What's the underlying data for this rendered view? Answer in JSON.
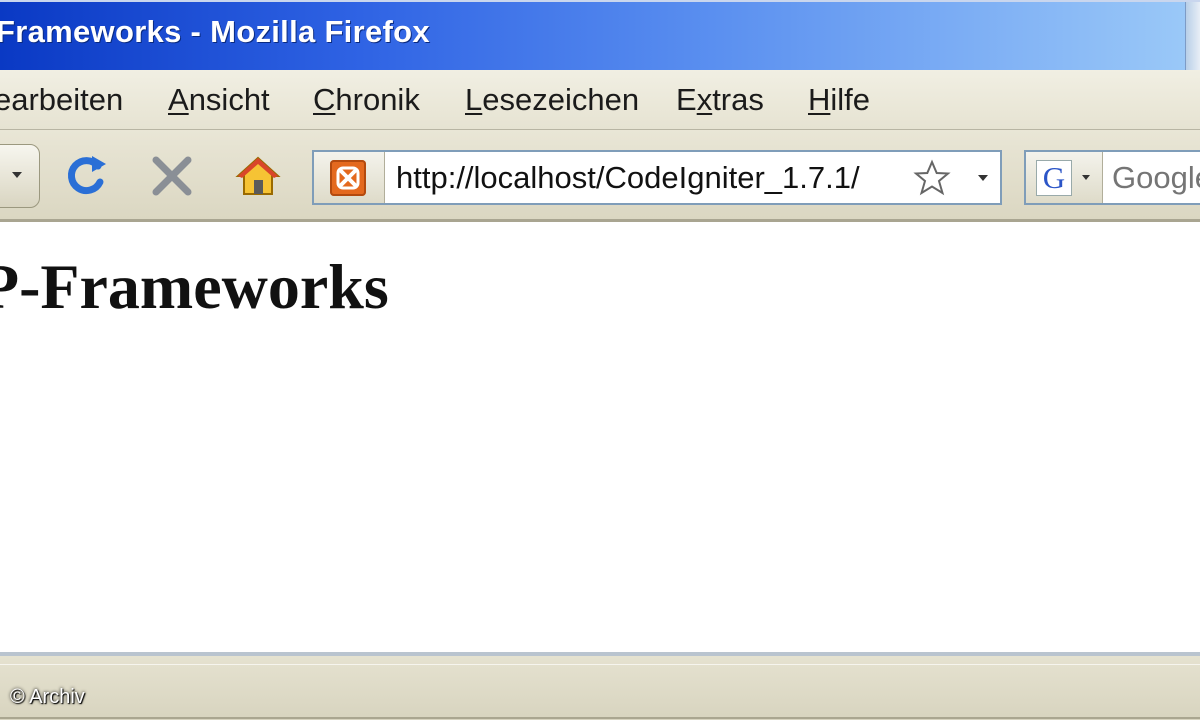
{
  "window": {
    "title": "Frameworks - Mozilla Firefox"
  },
  "menubar": {
    "items": [
      {
        "label_pre": "",
        "label_u": "",
        "label_post": "earbeiten"
      },
      {
        "label_pre": "",
        "label_u": "A",
        "label_post": "nsicht"
      },
      {
        "label_pre": "",
        "label_u": "C",
        "label_post": "hronik"
      },
      {
        "label_pre": "",
        "label_u": "L",
        "label_post": "esezeichen"
      },
      {
        "label_pre": "E",
        "label_u": "x",
        "label_post": "tras"
      },
      {
        "label_pre": "",
        "label_u": "H",
        "label_post": "ilfe"
      }
    ]
  },
  "navbar": {
    "url": "http://localhost/CodeIgniter_1.7.1/",
    "search_engine_letter": "G",
    "search_placeholder": "Google"
  },
  "page": {
    "heading": "P-Frameworks"
  },
  "credit": "© Archiv",
  "colors": {
    "titlebar_start": "#0a39c4",
    "titlebar_end": "#9ccaf8",
    "reload_icon": "#2a6fd6",
    "stop_icon": "#8a8f96",
    "home_icon": "#f0b020",
    "site_icon": "#e4691e"
  },
  "icons": [
    "back-dropdown-icon",
    "reload-icon",
    "stop-icon",
    "home-icon",
    "xampp-site-icon",
    "bookmark-star-icon",
    "google-search-icon"
  ]
}
